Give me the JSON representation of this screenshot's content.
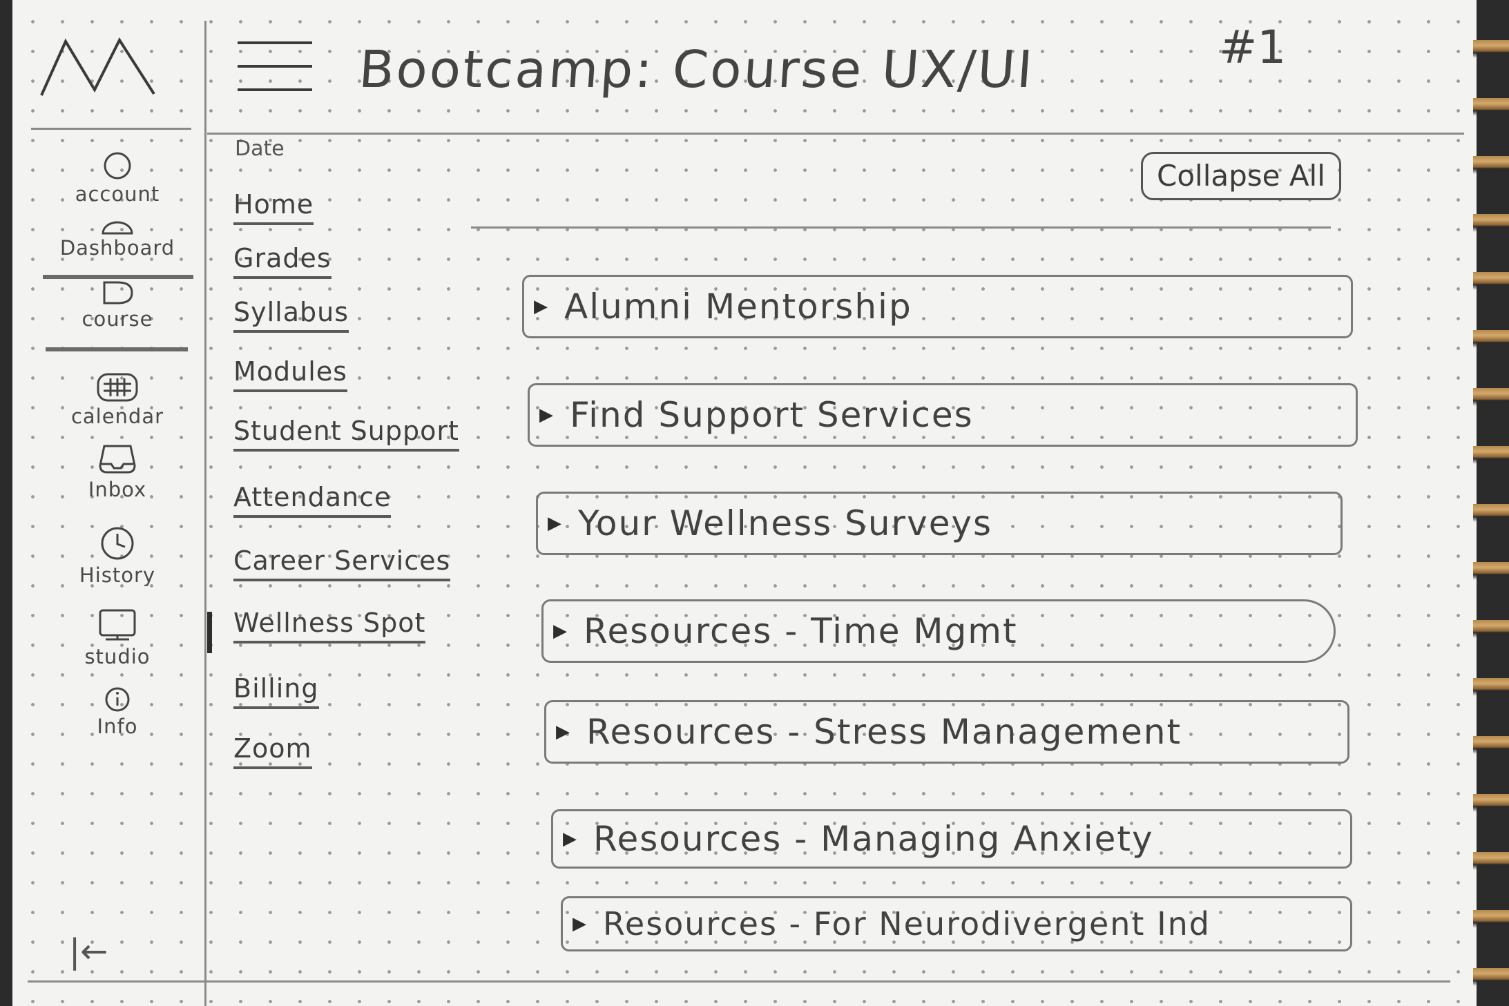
{
  "header": {
    "title": "Bootcamp: Course UX/UI",
    "sheet_number": "#1"
  },
  "rail": {
    "items": [
      {
        "label": "account",
        "icon": "account-icon"
      },
      {
        "label": "Dashboard",
        "icon": "dashboard-icon"
      },
      {
        "label": "course",
        "icon": "course-icon"
      },
      {
        "label": "calendar",
        "icon": "calendar-icon"
      },
      {
        "label": "Inbox",
        "icon": "inbox-icon"
      },
      {
        "label": "History",
        "icon": "history-icon"
      },
      {
        "label": "studio",
        "icon": "studio-icon"
      },
      {
        "label": "Info",
        "icon": "info-icon"
      }
    ],
    "collapse_icon": "|←"
  },
  "subnav": {
    "date_label": "Date",
    "items": [
      "Home",
      "Grades",
      "Syllabus",
      "Modules",
      "Student Support",
      "Attendance",
      "Career Services",
      "Wellness Spot",
      "Billing",
      "Zoom"
    ],
    "active": "Wellness Spot"
  },
  "main": {
    "collapse_label": "Collapse All",
    "modules": [
      "Alumni Mentorship",
      "Find Support Services",
      "Your Wellness Surveys",
      "Resources - Time Mgmt",
      "Resources - Stress Management",
      "Resources - Managing Anxiety",
      "Resources - For Neurodivergent Ind"
    ],
    "expand_glyph": "▶"
  }
}
